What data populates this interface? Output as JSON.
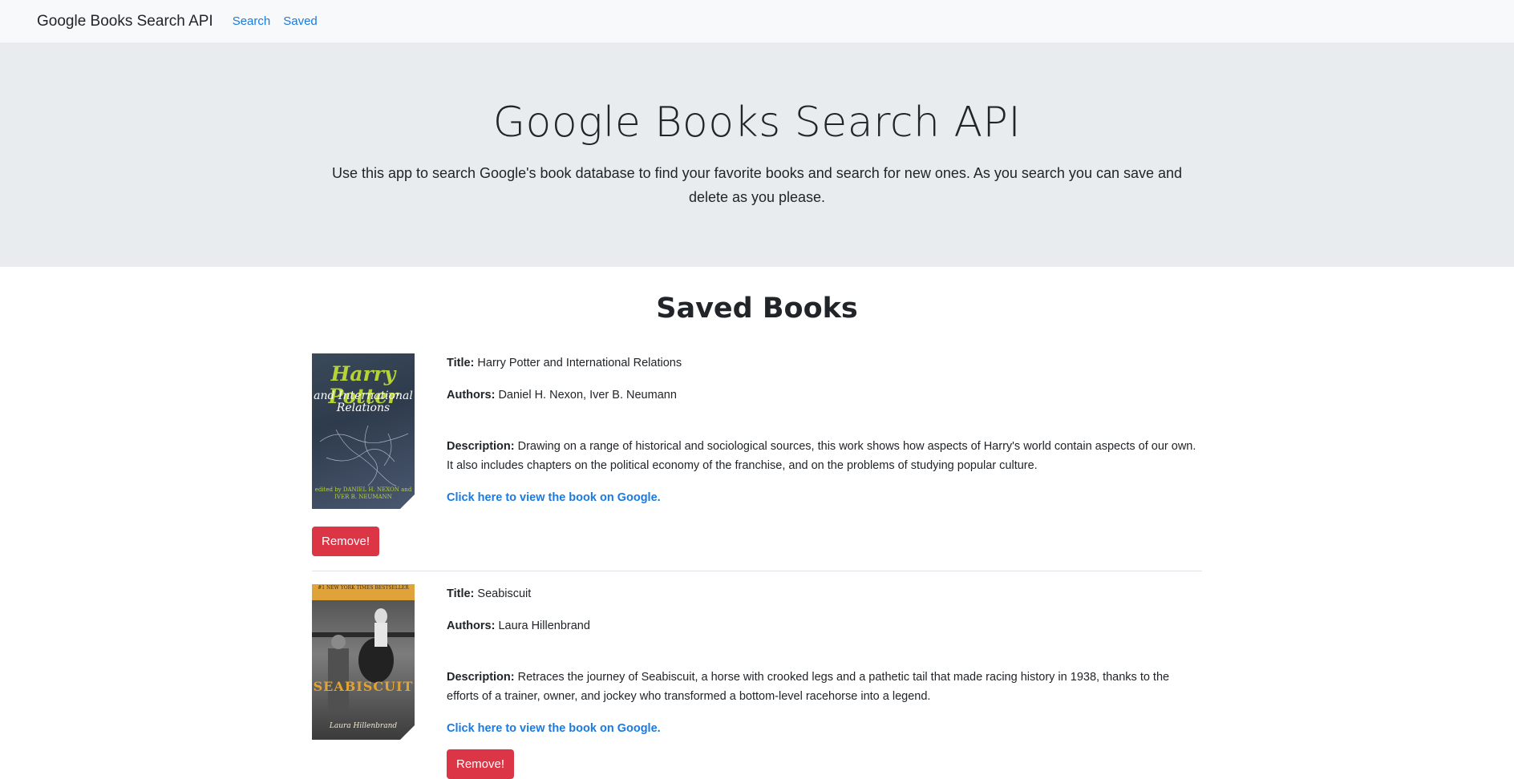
{
  "navbar": {
    "brand": "Google Books Search API",
    "links": [
      "Search",
      "Saved"
    ]
  },
  "jumbotron": {
    "title": "Google Books Search API",
    "lead": "Use this app to search Google's book database to find your favorite books and search for new ones. As you search you can save and delete as you please."
  },
  "saved": {
    "heading": "Saved Books",
    "labels": {
      "title": "Title:",
      "authors": "Authors:",
      "description": "Description:",
      "link": "Click here to view the book on Google.",
      "remove": "Remove!"
    },
    "books": [
      {
        "title": "Harry Potter and International Relations",
        "authors": "Daniel H. Nexon, Iver B. Neumann",
        "description": "Drawing on a range of historical and sociological sources, this work shows how aspects of Harry's world contain aspects of our own. It also includes chapters on the political economy of the franchise, and on the problems of studying popular culture.",
        "cover": {
          "title": "Harry Potter",
          "subtitle": "and International Relations",
          "editors": "edited by DANIEL H. NEXON and IVER B. NEUMANN"
        }
      },
      {
        "title": "Seabiscuit",
        "authors": "Laura Hillenbrand",
        "description": "Retraces the journey of Seabiscuit, a horse with crooked legs and a pathetic tail that made racing history in 1938, thanks to the efforts of a trainer, owner, and jockey who transformed a bottom-level racehorse into a legend.",
        "cover": {
          "band": "#1 NEW YORK TIMES BESTSELLER",
          "title": "SEABISCUIT",
          "author": "Laura Hillenbrand"
        }
      }
    ]
  }
}
